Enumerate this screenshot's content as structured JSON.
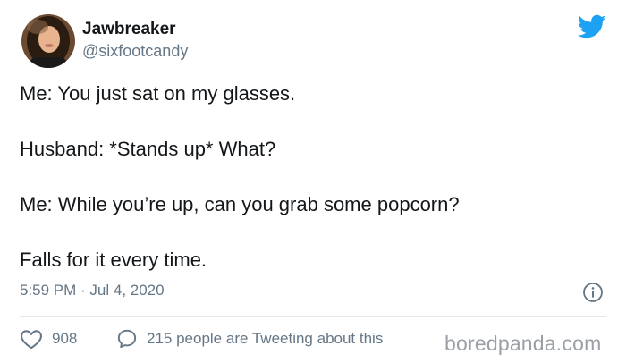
{
  "author": {
    "display_name": "Jawbreaker",
    "handle": "@sixfootcandy"
  },
  "tweet": {
    "lines": [
      "Me: You just sat on my glasses.",
      "Husband: *Stands up* What?",
      "Me: While you’re up, can you grab some popcorn?",
      "Falls for it every time."
    ],
    "timestamp": "5:59 PM · Jul 4, 2020"
  },
  "actions": {
    "likes": "908",
    "conversation": "215 people are Tweeting about this"
  },
  "watermark": "boredpanda.com",
  "icons": {
    "logo": "twitter-bird-icon",
    "info": "info-icon",
    "like": "heart-icon",
    "comment": "speech-bubble-icon"
  },
  "colors": {
    "brand": "#1da1f2",
    "text_primary": "#14171a",
    "text_secondary": "#657786",
    "divider": "#e1e8ed"
  }
}
